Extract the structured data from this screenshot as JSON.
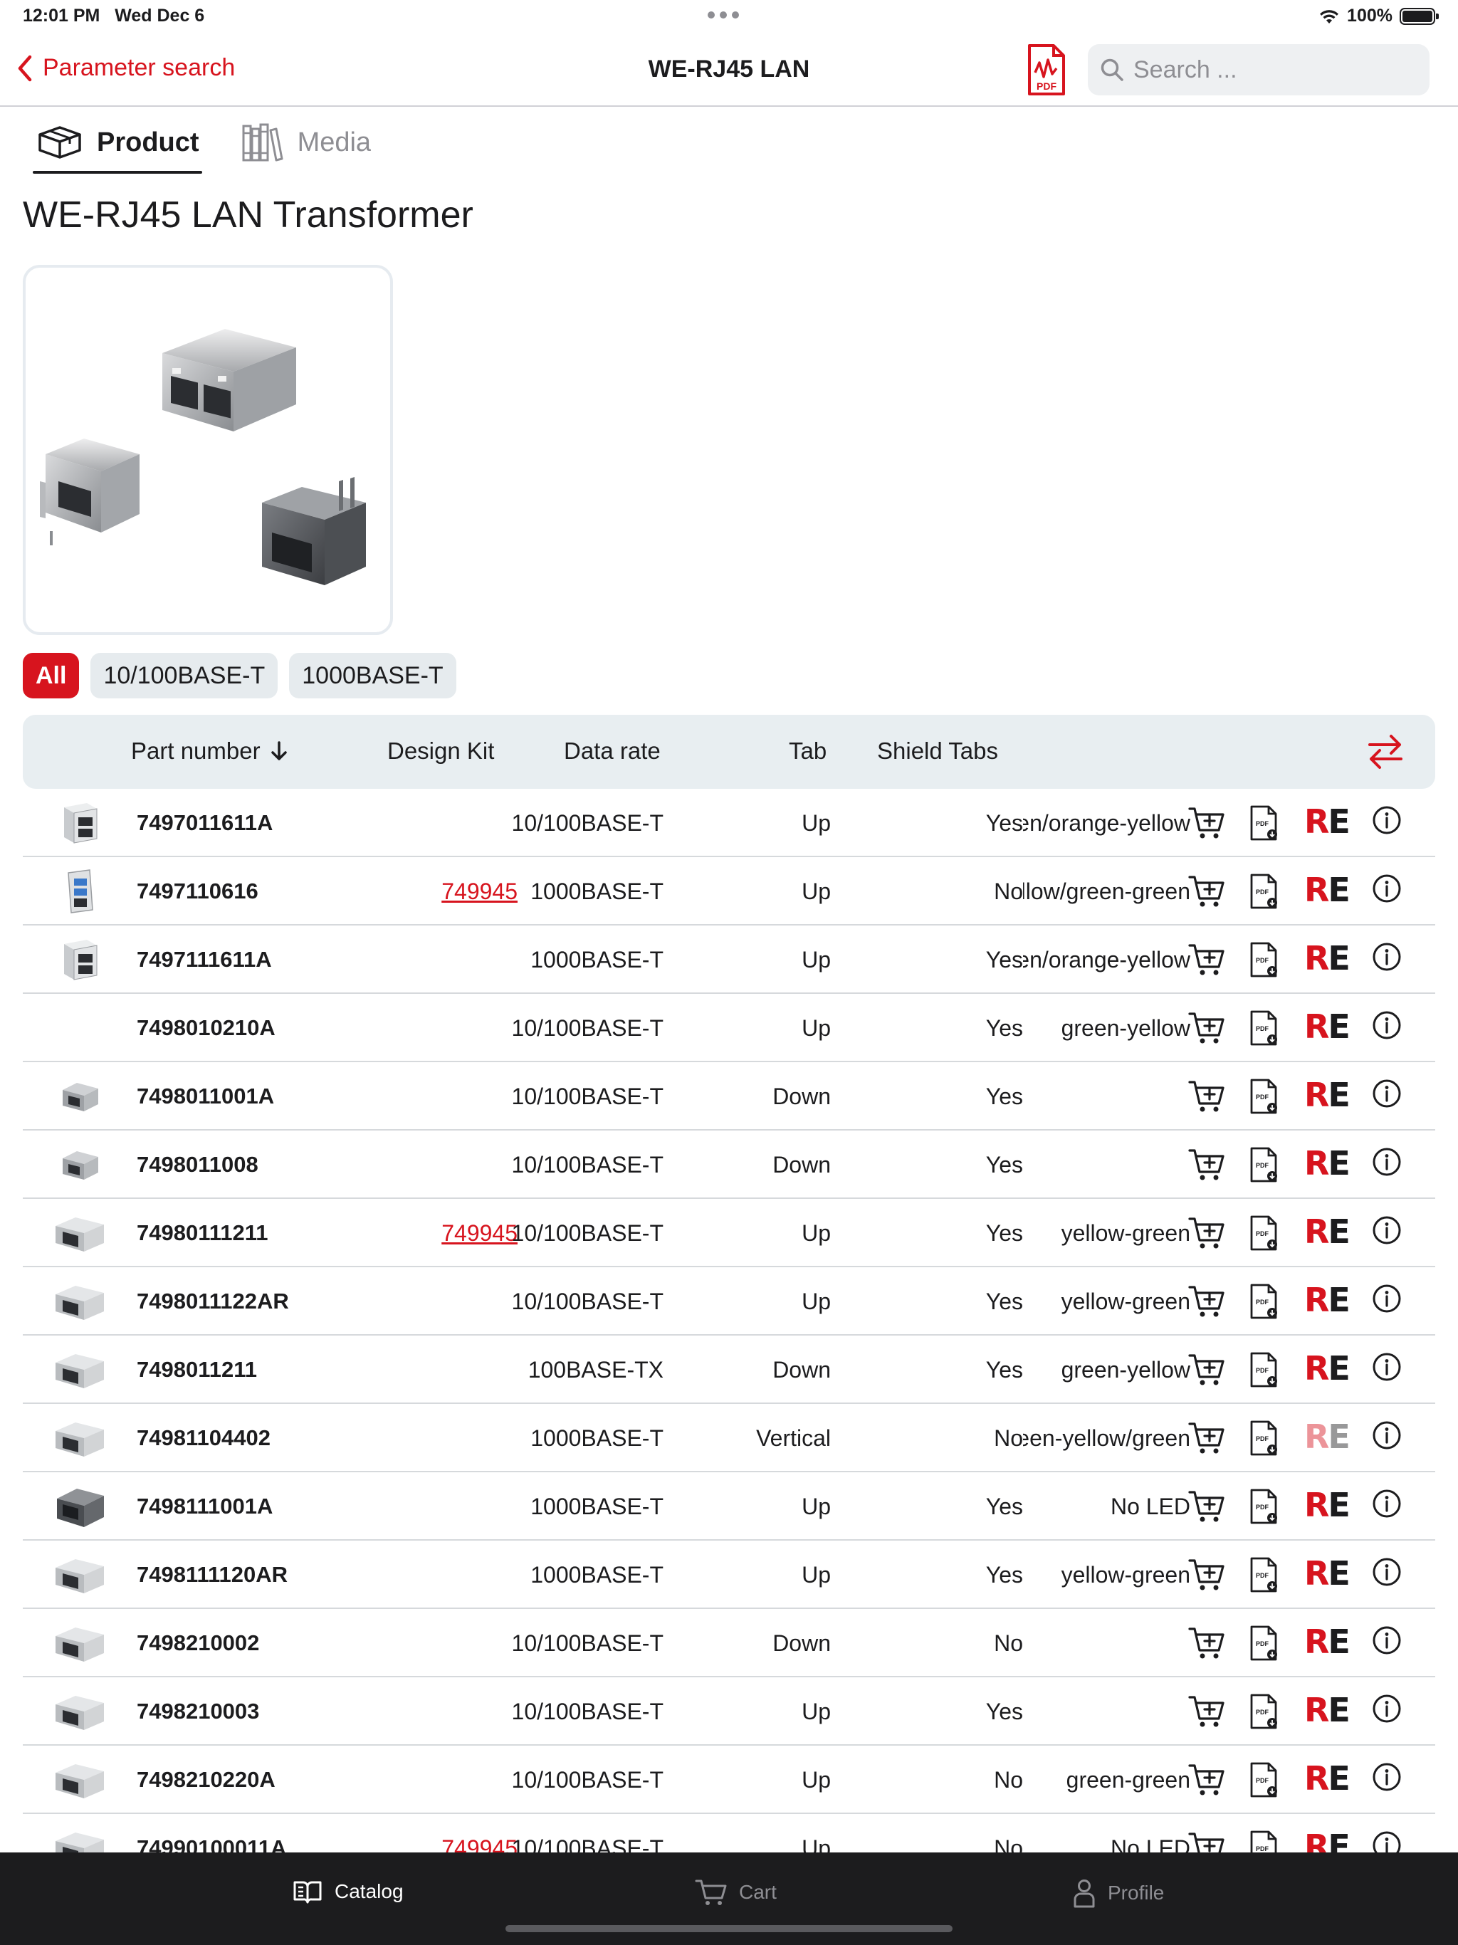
{
  "status_bar": {
    "time": "12:01 PM",
    "date": "Wed Dec 6",
    "battery": "100%"
  },
  "nav": {
    "back_label": "Parameter search",
    "title": "WE-RJ45 LAN",
    "pdf_label": "PDF",
    "search_placeholder": "Search ..."
  },
  "tabs": [
    {
      "label": "Product",
      "active": true,
      "icon": "box-icon"
    },
    {
      "label": "Media",
      "active": false,
      "icon": "books-icon"
    }
  ],
  "product": {
    "title": "WE-RJ45 LAN Transformer"
  },
  "filters": [
    {
      "label": "All",
      "active": true
    },
    {
      "label": "10/100BASE-T",
      "active": false
    },
    {
      "label": "1000BASE-T",
      "active": false
    }
  ],
  "table": {
    "headers": {
      "part_number": "Part number",
      "design_kit": "Design Kit",
      "data_rate": "Data rate",
      "tab": "Tab",
      "shield_tabs": "Shield Tabs"
    },
    "rows": [
      {
        "part": "7497011611A",
        "kit": "",
        "rate": "10/100BASE-T",
        "tab": "Up",
        "shield": "Yes",
        "led": "green/orange-yellow",
        "re_faded": false,
        "thumb": "white"
      },
      {
        "part": "7497110616",
        "kit": "749945",
        "rate": "1000BASE-T",
        "tab": "Up",
        "shield": "No",
        "led": "yellow/green-green",
        "re_faded": false,
        "thumb": "usb"
      },
      {
        "part": "7497111611A",
        "kit": "",
        "rate": "1000BASE-T",
        "tab": "Up",
        "shield": "Yes",
        "led": "green/orange-yellow",
        "re_faded": false,
        "thumb": "white"
      },
      {
        "part": "7498010210A",
        "kit": "",
        "rate": "10/100BASE-T",
        "tab": "Up",
        "shield": "Yes",
        "led": "green-yellow",
        "re_faded": false,
        "thumb": "none"
      },
      {
        "part": "7498011001A",
        "kit": "",
        "rate": "10/100BASE-T",
        "tab": "Down",
        "shield": "Yes",
        "led": "",
        "re_faded": false,
        "thumb": "small"
      },
      {
        "part": "7498011008",
        "kit": "",
        "rate": "10/100BASE-T",
        "tab": "Down",
        "shield": "Yes",
        "led": "",
        "re_faded": false,
        "thumb": "small"
      },
      {
        "part": "74980111211",
        "kit": "749945",
        "rate": "10/100BASE-T",
        "tab": "Up",
        "shield": "Yes",
        "led": "yellow-green",
        "re_faded": false,
        "thumb": "jack"
      },
      {
        "part": "7498011122AR",
        "kit": "",
        "rate": "10/100BASE-T",
        "tab": "Up",
        "shield": "Yes",
        "led": "yellow-green",
        "re_faded": false,
        "thumb": "jack"
      },
      {
        "part": "7498011211",
        "kit": "",
        "rate": "100BASE-TX",
        "tab": "Down",
        "shield": "Yes",
        "led": "green-yellow",
        "re_faded": false,
        "thumb": "jack"
      },
      {
        "part": "74981104402",
        "kit": "",
        "rate": "1000BASE-T",
        "tab": "Vertical",
        "shield": "No",
        "led": "green-yellow/green",
        "re_faded": true,
        "thumb": "jack"
      },
      {
        "part": "7498111001A",
        "kit": "",
        "rate": "1000BASE-T",
        "tab": "Up",
        "shield": "Yes",
        "led": "No LED",
        "re_faded": false,
        "thumb": "dark"
      },
      {
        "part": "7498111120AR",
        "kit": "",
        "rate": "1000BASE-T",
        "tab": "Up",
        "shield": "Yes",
        "led": "yellow-green",
        "re_faded": false,
        "thumb": "jack"
      },
      {
        "part": "7498210002",
        "kit": "",
        "rate": "10/100BASE-T",
        "tab": "Down",
        "shield": "No",
        "led": "",
        "re_faded": false,
        "thumb": "jack"
      },
      {
        "part": "7498210003",
        "kit": "",
        "rate": "10/100BASE-T",
        "tab": "Up",
        "shield": "Yes",
        "led": "",
        "re_faded": false,
        "thumb": "jack"
      },
      {
        "part": "7498210220A",
        "kit": "",
        "rate": "10/100BASE-T",
        "tab": "Up",
        "shield": "No",
        "led": "green-green",
        "re_faded": false,
        "thumb": "jack"
      },
      {
        "part": "74990100011A",
        "kit": "749945",
        "rate": "10/100BASE-T",
        "tab": "Up",
        "shield": "No",
        "led": "No LED",
        "re_faded": false,
        "thumb": "jack"
      }
    ],
    "re_label": "RE"
  },
  "tabbar": [
    {
      "label": "Catalog",
      "active": true,
      "icon": "catalog-book-icon"
    },
    {
      "label": "Cart",
      "active": false,
      "icon": "cart-icon"
    },
    {
      "label": "Profile",
      "active": false,
      "icon": "profile-icon"
    }
  ],
  "colors": {
    "accent": "#d7141e",
    "header_bg": "#e8eef1",
    "tabbar_bg": "#1c1c1e"
  }
}
